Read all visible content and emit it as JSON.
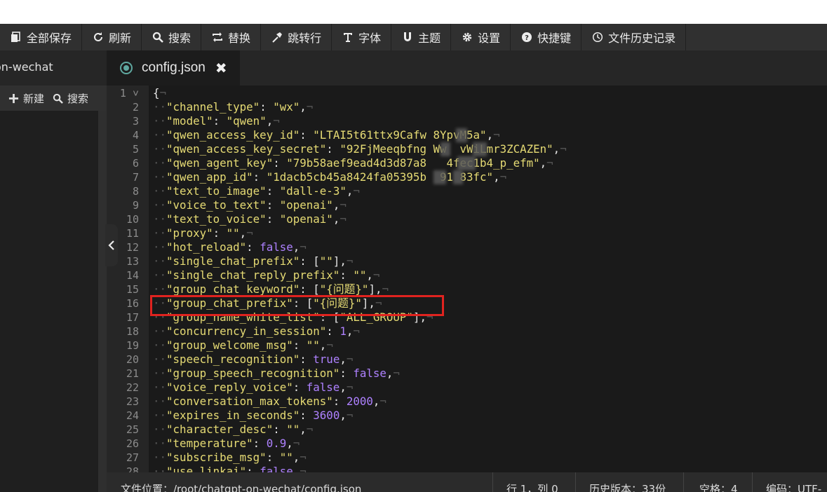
{
  "toolbar": {
    "items": [
      {
        "label": "全部保存",
        "icon": "save-all-icon"
      },
      {
        "label": "刷新",
        "icon": "refresh-icon"
      },
      {
        "label": "搜索",
        "icon": "search-icon"
      },
      {
        "label": "替换",
        "icon": "replace-icon"
      },
      {
        "label": "跳转行",
        "icon": "goto-line-icon"
      },
      {
        "label": "字体",
        "icon": "font-icon"
      },
      {
        "label": "主题",
        "icon": "theme-icon"
      },
      {
        "label": "设置",
        "icon": "gear-icon"
      },
      {
        "label": "快捷键",
        "icon": "help-icon"
      },
      {
        "label": "文件历史记录",
        "icon": "history-icon"
      }
    ]
  },
  "sidebar": {
    "title": "on-wechat",
    "new_label": "新建",
    "search_label": "搜索"
  },
  "tab": {
    "filename": "config.json",
    "close": "✖"
  },
  "editor": {
    "lines": [
      "{",
      "  \"channel_type\": \"wx\",",
      "  \"model\": \"qwen\",",
      "  \"qwen_access_key_id\": \"LTAI5t61ttx9Cafw 8YpvM5a\",",
      "  \"qwen_access_key_secret\": \"92FjMeeqbfng Ww  vWiLmr3ZCAZEn\",",
      "  \"qwen_agent_key\": \"79b58aef9ead4d3d87a8   4fec1b4_p_efm\",",
      "  \"qwen_app_id\": \"1dacb5cb45a8424fa05395b  91 83fc\",",
      "  \"text_to_image\": \"dall-e-3\",",
      "  \"voice_to_text\": \"openai\",",
      "  \"text_to_voice\": \"openai\",",
      "  \"proxy\": \"\",",
      "  \"hot_reload\": false,",
      "  \"single_chat_prefix\": [\"\"],",
      "  \"single_chat_reply_prefix\": \"\",",
      "  \"group_chat_keyword\": [\"{问题}\"],",
      "  \"group_chat_prefix\": [\"{问题}\"],",
      "  \"group_name_white_list\": [\"ALL_GROUP\"],",
      "  \"concurrency_in_session\": 1,",
      "  \"group_welcome_msg\": \"\",",
      "  \"speech_recognition\": true,",
      "  \"group_speech_recognition\": false,",
      "  \"voice_reply_voice\": false,",
      "  \"conversation_max_tokens\": 2000,",
      "  \"expires_in_seconds\": 3600,",
      "  \"character_desc\": \"\",",
      "  \"temperature\": 0.9,",
      "  \"subscribe_msg\": \"\",",
      "  \"use_linkai\": false,"
    ]
  },
  "status": {
    "file_location": "文件位置：/root/chatgpt-on-wechat/config.json",
    "cursor": "行 1，列 0",
    "history_version": "历史版本：33份",
    "indent": "空格：4",
    "encoding": "编码：UTF-"
  },
  "colors": {
    "highlight_box": "#e0231f",
    "keyword_yellow": "#e6db74",
    "literal_purple": "#ae81ff"
  }
}
